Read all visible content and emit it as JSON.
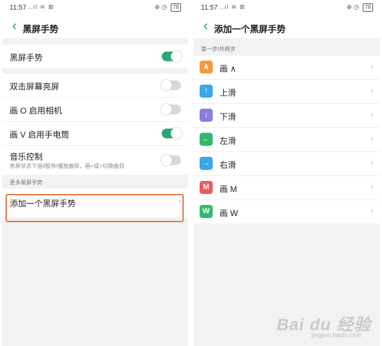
{
  "left": {
    "status": {
      "time": "11:57",
      "signal": "..ıl ≋ ⊠",
      "icons": "⊕ ◷",
      "battery": "78"
    },
    "title": "黑屏手势",
    "master": {
      "label": "黑屏手势",
      "on": true
    },
    "rows": [
      {
        "label": "双击屏幕亮屏",
        "on": false
      },
      {
        "label": "画 O 启用相机",
        "on": false
      },
      {
        "label": "画 V 启用手电筒",
        "on": true
      },
      {
        "label": "音乐控制",
        "sub": "息屏状态下画‖暂停/播放曲目，画<或>切换曲目",
        "on": false
      }
    ],
    "section": "更多黑屏手势",
    "add_label": "添加一个黑屏手势",
    "chevron": "›"
  },
  "right": {
    "status": {
      "time": "11:57",
      "signal": "..ıl ≋ ⊠",
      "icons": "⊕ ◷",
      "battery": "78"
    },
    "title": "添加一个黑屏手势",
    "section": "第一步/共两步",
    "chevron": "›",
    "gestures": [
      {
        "label": "画 ∧",
        "icon": "∧",
        "color": "#f59a3c",
        "icon_name": "caret-up-icon"
      },
      {
        "label": "上滑",
        "icon": "↑",
        "color": "#3aa7e8",
        "icon_name": "arrow-up-icon"
      },
      {
        "label": "下滑",
        "icon": "↓",
        "color": "#8a7ee0",
        "icon_name": "arrow-down-icon"
      },
      {
        "label": "左滑",
        "icon": "←",
        "color": "#35b86e",
        "icon_name": "arrow-left-icon"
      },
      {
        "label": "右滑",
        "icon": "→",
        "color": "#3aa7e8",
        "icon_name": "arrow-right-icon"
      },
      {
        "label": "画 M",
        "icon": "M",
        "color": "#ee5a5a",
        "icon_name": "letter-m-icon"
      },
      {
        "label": "画 W",
        "icon": "W",
        "color": "#35b86e",
        "icon_name": "letter-w-icon"
      }
    ]
  },
  "back_glyph": "‹",
  "watermark": {
    "text": "Bai du 经验",
    "sub": "jingyan.baidu.com"
  }
}
